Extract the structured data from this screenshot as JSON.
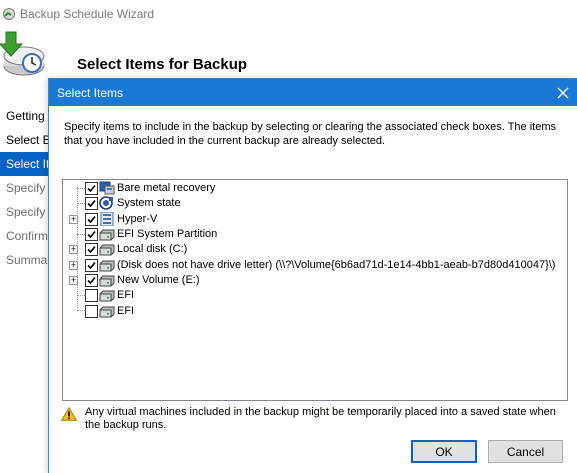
{
  "wizard": {
    "title": "Backup Schedule Wizard",
    "heading": "Select Items for Backup",
    "steps": [
      {
        "label": "Getting S",
        "state": "done"
      },
      {
        "label": "Select Ba",
        "state": "done"
      },
      {
        "label": "Select Ite",
        "state": "active"
      },
      {
        "label": "Specify B",
        "state": "pending"
      },
      {
        "label": "Specify D",
        "state": "pending"
      },
      {
        "label": "Confirm",
        "state": "pending"
      },
      {
        "label": "Summar",
        "state": "pending"
      }
    ]
  },
  "dialog": {
    "title": "Select Items",
    "description": "Specify items to include in the backup by selecting or clearing the associated check boxes. The items that you have included in the current backup are already selected.",
    "items": [
      {
        "label": "Bare metal recovery",
        "checked": true,
        "expandable": false,
        "icon": "bare-metal-icon"
      },
      {
        "label": "System state",
        "checked": true,
        "expandable": false,
        "icon": "system-state-icon"
      },
      {
        "label": "Hyper-V",
        "checked": true,
        "expandable": true,
        "icon": "hyperv-icon"
      },
      {
        "label": "EFI System Partition",
        "checked": true,
        "expandable": false,
        "icon": "drive-icon"
      },
      {
        "label": "Local disk (C:)",
        "checked": true,
        "expandable": true,
        "icon": "drive-icon"
      },
      {
        "label": "(Disk does not have drive letter) (\\\\?\\Volume{6b6ad71d-1e14-4bb1-aeab-b7d80d410047}\\)",
        "checked": true,
        "expandable": true,
        "icon": "drive-icon"
      },
      {
        "label": "New Volume (E:)",
        "checked": true,
        "expandable": true,
        "icon": "drive-icon"
      },
      {
        "label": "EFI",
        "checked": false,
        "expandable": false,
        "icon": "drive-icon"
      },
      {
        "label": "EFI",
        "checked": false,
        "expandable": false,
        "icon": "drive-icon"
      }
    ],
    "warning": "Any virtual machines included in the backup might be temporarily placed into a saved state when the backup runs.",
    "ok_label": "OK",
    "cancel_label": "Cancel"
  },
  "colors": {
    "accent": "#1a78d6",
    "selected_step": "#0a64c6"
  }
}
